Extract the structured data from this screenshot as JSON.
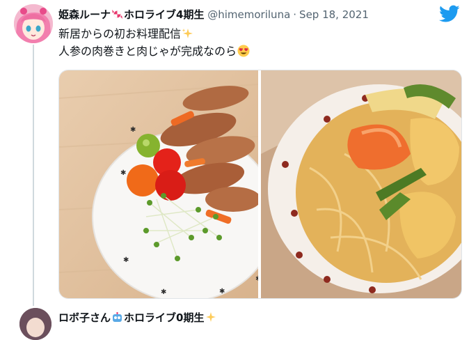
{
  "tweet": {
    "display_name": "姫森ルーナ",
    "name_suffix": "ホロライブ4期生",
    "handle": "@himemoriluna",
    "date": "Sep 18, 2021",
    "text_line1": "新居からの初お料理配信",
    "text_line2": "人参の肉巻きと肉じゃが完成なのら",
    "icons": [
      "avatar-luna",
      "candy-emoji",
      "sparkle-emoji",
      "heart-eyes-emoji",
      "twitter-bird-icon"
    ],
    "photos": [
      "photo-carrot-meat-rolls",
      "photo-nikujaga"
    ]
  },
  "next_tweet": {
    "display_name": "ロボ子さん",
    "name_suffix": "ホロライブ0期生"
  },
  "colors": {
    "twitter_blue": "#1d9bf0",
    "secondary_text": "#536471",
    "thread_line": "#cfd9de"
  }
}
